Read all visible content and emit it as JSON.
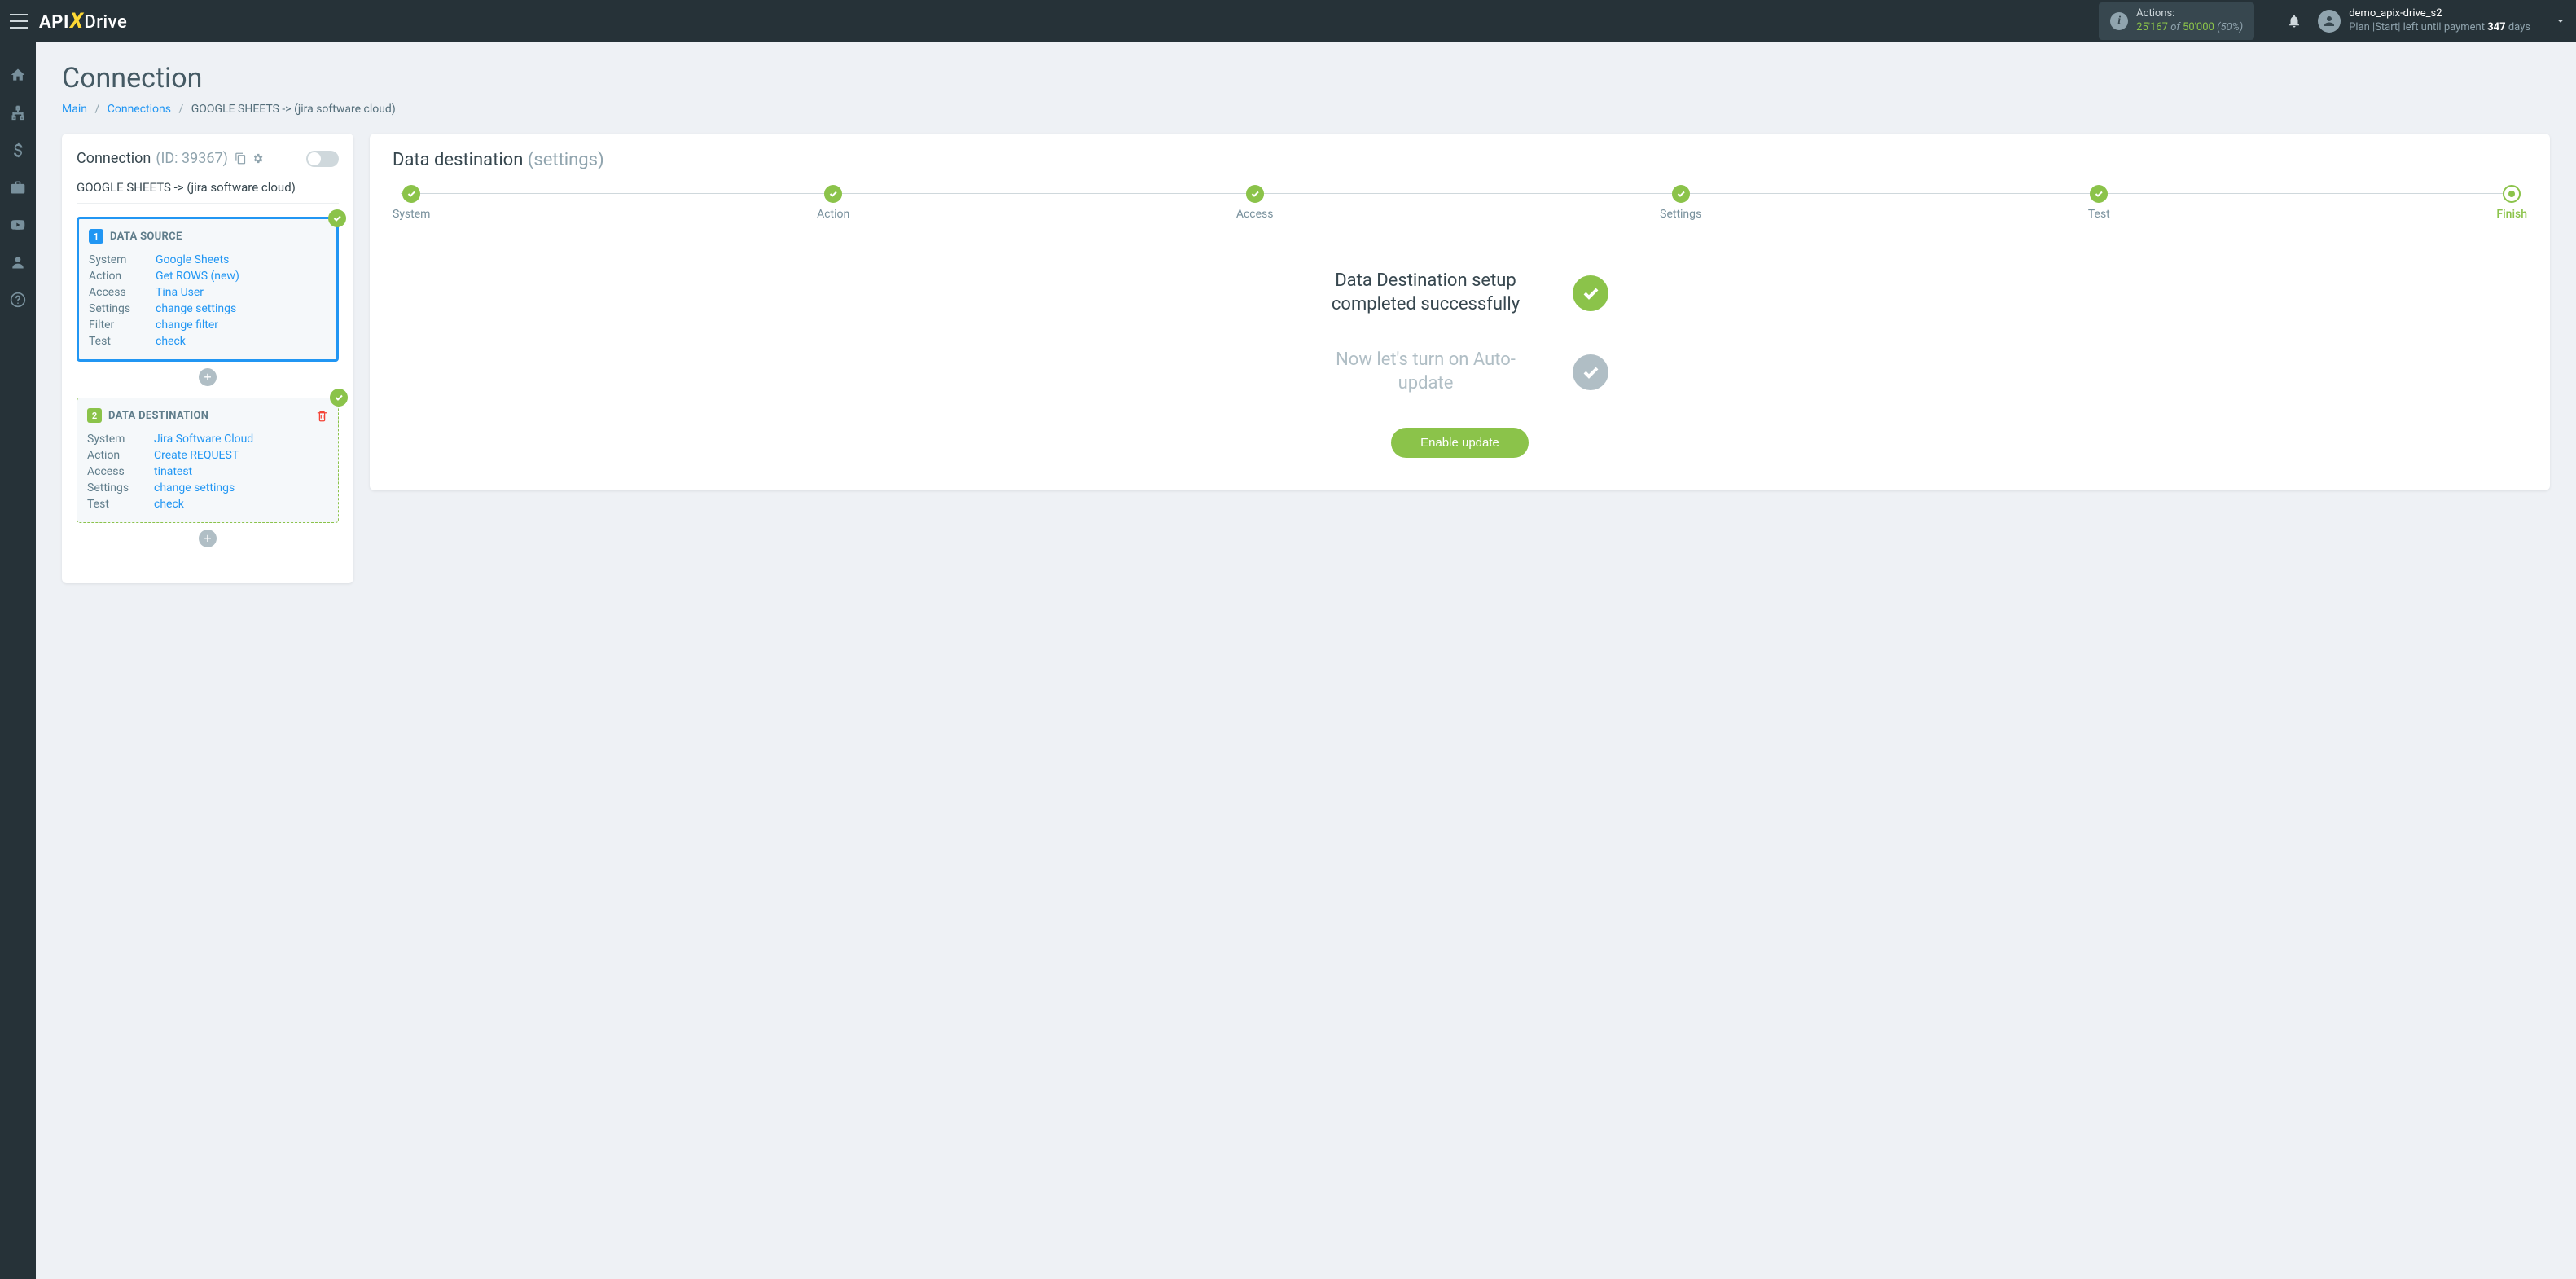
{
  "topbar": {
    "logo_api": "API",
    "logo_drive": "Drive",
    "actions_label": "Actions:",
    "actions_used": "25'167",
    "actions_of": "of",
    "actions_total": "50'000",
    "actions_pct": "(50%)",
    "user_name": "demo_apix-drive_s2",
    "plan_prefix": "Plan |Start| left until payment ",
    "plan_days": "347",
    "plan_suffix": " days"
  },
  "page": {
    "title": "Connection",
    "breadcrumb_main": "Main",
    "breadcrumb_connections": "Connections",
    "breadcrumb_current": "GOOGLE SHEETS -> (jira software cloud)"
  },
  "left": {
    "header_title": "Connection",
    "header_id": "(ID: 39367)",
    "conn_name": "GOOGLE SHEETS -> (jira software cloud)",
    "source": {
      "num": "1",
      "title": "DATA SOURCE",
      "rows": [
        {
          "key": "System",
          "val": "Google Sheets"
        },
        {
          "key": "Action",
          "val": "Get ROWS (new)"
        },
        {
          "key": "Access",
          "val": "Tina User"
        },
        {
          "key": "Settings",
          "val": "change settings"
        },
        {
          "key": "Filter",
          "val": "change filter"
        },
        {
          "key": "Test",
          "val": "check"
        }
      ]
    },
    "dest": {
      "num": "2",
      "title": "DATA DESTINATION",
      "rows": [
        {
          "key": "System",
          "val": "Jira Software Cloud"
        },
        {
          "key": "Action",
          "val": "Create REQUEST"
        },
        {
          "key": "Access",
          "val": "tinatest"
        },
        {
          "key": "Settings",
          "val": "change settings"
        },
        {
          "key": "Test",
          "val": "check"
        }
      ]
    }
  },
  "right": {
    "title": "Data destination",
    "subtitle": "(settings)",
    "steps": [
      "System",
      "Action",
      "Access",
      "Settings",
      "Test",
      "Finish"
    ],
    "msg_done": "Data Destination setup completed successfully",
    "msg_pending": "Now let's turn on Auto-update",
    "button": "Enable update"
  }
}
